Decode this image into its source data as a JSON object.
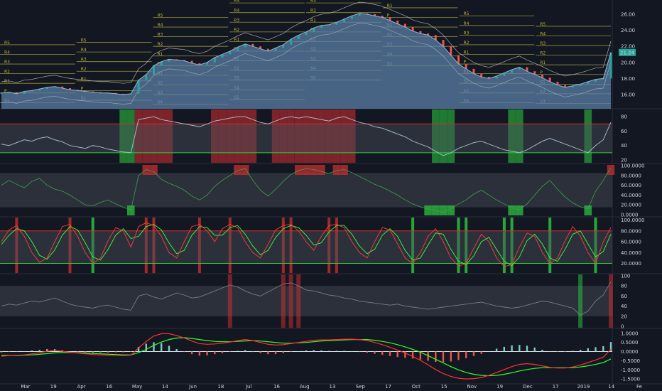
{
  "chart_data": {
    "type": "line",
    "colors": {
      "background": "#131722",
      "area_fill": "#5b7fa6",
      "area_line": "#8fb3d6",
      "candle_up": "#26a69a",
      "candle_down": "#ef5350",
      "pivot_line": "#b7b13a",
      "green_zone": "#2ecc40",
      "red_zone": "#d32f2f",
      "band_fill": "#4a4f5c",
      "oscillator": "#9fb7c9",
      "stoch_k": "#ff3b3b",
      "stoch_d": "#3bff3b",
      "macd_line": "#ff3030",
      "signal_line": "#30ff30",
      "hist_pos": "#80cbc4",
      "hist_neg": "#ef5350"
    },
    "x_ticks": [
      "Mar",
      "19",
      "Apr",
      "16",
      "May",
      "14",
      "Jun",
      "18",
      "Jul",
      "16",
      "Aug",
      "13",
      "Sep",
      "17",
      "Oct",
      "15",
      "Nov",
      "19",
      "Dec",
      "17",
      "2019",
      "14",
      "Fe"
    ],
    "panels": [
      {
        "name": "price",
        "y_ticks": [
          "26.00",
          "24.00",
          "22.00",
          "20.00",
          "18.00",
          "16.00"
        ],
        "ylim": [
          14.5,
          27.5
        ],
        "last_label": "21.24",
        "pivot_labels": [
          "R5",
          "R4",
          "R3",
          "R2",
          "R1",
          "P",
          "S1",
          "S2",
          "S3",
          "S4",
          "S5"
        ],
        "close": [
          16.2,
          16.3,
          16.1,
          16.4,
          16.5,
          16.7,
          16.9,
          17.0,
          16.8,
          16.6,
          16.5,
          16.4,
          16.3,
          16.2,
          16.2,
          16.1,
          16.0,
          16.1,
          17.8,
          18.5,
          19.6,
          20.1,
          20.4,
          20.3,
          20.2,
          19.9,
          19.7,
          20.0,
          20.6,
          21.0,
          21.4,
          21.9,
          22.3,
          22.0,
          21.7,
          21.4,
          21.8,
          22.2,
          22.9,
          23.4,
          23.8,
          24.3,
          24.6,
          24.7,
          25.0,
          25.4,
          25.8,
          26.1,
          26.0,
          25.8,
          25.6,
          25.2,
          24.8,
          24.4,
          23.9,
          23.6,
          23.4,
          22.8,
          22.0,
          20.9,
          19.8,
          19.2,
          18.6,
          18.2,
          18.0,
          18.3,
          18.7,
          19.1,
          19.4,
          18.9,
          18.5,
          18.1,
          17.6,
          17.2,
          16.9,
          17.1,
          17.3,
          17.6,
          17.9,
          18.0,
          21.24
        ]
      },
      {
        "name": "oscillator-1",
        "y_ticks": [
          "80",
          "60",
          "40",
          "20"
        ],
        "ylim": [
          18,
          88
        ],
        "bands": [
          30,
          70
        ],
        "values": [
          42,
          40,
          44,
          48,
          46,
          50,
          52,
          48,
          45,
          40,
          38,
          36,
          40,
          38,
          35,
          33,
          31,
          30,
          76,
          78,
          80,
          76,
          74,
          72,
          70,
          68,
          66,
          70,
          74,
          76,
          78,
          80,
          80,
          76,
          72,
          70,
          74,
          78,
          80,
          78,
          80,
          78,
          76,
          74,
          78,
          80,
          76,
          72,
          70,
          66,
          64,
          60,
          56,
          52,
          46,
          42,
          38,
          32,
          26,
          30,
          36,
          40,
          44,
          46,
          42,
          38,
          34,
          32,
          30,
          34,
          40,
          46,
          50,
          46,
          42,
          38,
          34,
          30,
          40,
          48,
          72
        ]
      },
      {
        "name": "oscillator-2",
        "y_ticks": [
          "100.0000",
          "80.0000",
          "60.0000",
          "40.0000",
          "20.0000",
          "0.0000"
        ],
        "ylim": [
          0,
          100
        ],
        "bands": [
          10,
          90
        ],
        "values": [
          60,
          70,
          62,
          55,
          68,
          74,
          60,
          52,
          48,
          40,
          30,
          20,
          18,
          25,
          30,
          22,
          15,
          10,
          80,
          92,
          88,
          72,
          64,
          58,
          50,
          38,
          30,
          40,
          58,
          70,
          80,
          90,
          94,
          70,
          50,
          38,
          52,
          68,
          82,
          90,
          94,
          92,
          88,
          84,
          90,
          92,
          86,
          78,
          70,
          62,
          56,
          48,
          40,
          30,
          22,
          16,
          12,
          8,
          5,
          12,
          22,
          30,
          42,
          50,
          40,
          30,
          22,
          14,
          10,
          22,
          40,
          58,
          70,
          52,
          36,
          24,
          16,
          12,
          48,
          70,
          96
        ]
      },
      {
        "name": "stochastic",
        "y_ticks": [
          "100.0000",
          "80.0000",
          "60.0000",
          "40.0000",
          "20.0000"
        ],
        "ylim": [
          5,
          102
        ],
        "bands": [
          20,
          80
        ],
        "k": [
          60,
          82,
          90,
          70,
          40,
          22,
          30,
          60,
          88,
          92,
          70,
          40,
          20,
          30,
          62,
          86,
          80,
          50,
          88,
          95,
          90,
          70,
          40,
          30,
          60,
          88,
          92,
          80,
          60,
          84,
          92,
          86,
          60,
          40,
          30,
          55,
          82,
          90,
          92,
          80,
          60,
          44,
          70,
          90,
          92,
          86,
          60,
          40,
          30,
          60,
          86,
          82,
          56,
          30,
          20,
          40,
          70,
          84,
          60,
          30,
          15,
          20,
          48,
          74,
          60,
          30,
          14,
          18,
          50,
          76,
          70,
          40,
          20,
          30,
          62,
          88,
          70,
          40,
          20,
          60,
          86
        ],
        "d": [
          55,
          72,
          84,
          80,
          60,
          35,
          28,
          45,
          72,
          88,
          82,
          58,
          32,
          26,
          46,
          72,
          84,
          66,
          70,
          88,
          92,
          82,
          58,
          38,
          44,
          72,
          88,
          86,
          72,
          72,
          86,
          90,
          74,
          52,
          36,
          44,
          68,
          84,
          90,
          86,
          72,
          54,
          58,
          78,
          90,
          90,
          74,
          52,
          38,
          46,
          72,
          84,
          70,
          44,
          26,
          30,
          54,
          76,
          74,
          46,
          24,
          18,
          34,
          60,
          68,
          46,
          24,
          16,
          32,
          62,
          74,
          56,
          30,
          24,
          46,
          74,
          80,
          56,
          32,
          42,
          74
        ]
      },
      {
        "name": "oscillator-4",
        "y_ticks": [
          "100",
          "80",
          "60",
          "40",
          "20",
          "0"
        ],
        "ylim": [
          0,
          100
        ],
        "bands": [
          20,
          80
        ],
        "values": [
          40,
          44,
          42,
          46,
          50,
          48,
          52,
          56,
          50,
          44,
          40,
          38,
          36,
          40,
          42,
          38,
          34,
          32,
          60,
          64,
          58,
          54,
          60,
          66,
          62,
          56,
          58,
          64,
          70,
          76,
          82,
          78,
          70,
          64,
          60,
          68,
          76,
          84,
          86,
          80,
          72,
          70,
          66,
          62,
          60,
          56,
          54,
          50,
          48,
          46,
          44,
          42,
          44,
          40,
          38,
          36,
          34,
          36,
          38,
          40,
          42,
          44,
          46,
          48,
          44,
          40,
          38,
          36,
          38,
          42,
          46,
          50,
          48,
          44,
          40,
          36,
          22,
          30,
          50,
          62,
          88
        ]
      },
      {
        "name": "macd",
        "y_ticks": [
          "1.0000",
          "0.5000",
          "0.0000",
          "-0.5000",
          "-1.0000",
          "-1.5000"
        ],
        "ylim": [
          -1.65,
          1.15
        ],
        "macd": [
          -0.25,
          -0.22,
          -0.2,
          -0.18,
          -0.12,
          -0.06,
          0.02,
          0.06,
          0.02,
          -0.04,
          -0.08,
          -0.12,
          -0.16,
          -0.18,
          -0.19,
          -0.2,
          -0.22,
          -0.2,
          0.2,
          0.55,
          0.85,
          0.98,
          0.98,
          0.88,
          0.74,
          0.58,
          0.44,
          0.4,
          0.42,
          0.46,
          0.52,
          0.6,
          0.66,
          0.6,
          0.5,
          0.4,
          0.36,
          0.38,
          0.44,
          0.5,
          0.56,
          0.62,
          0.64,
          0.64,
          0.66,
          0.68,
          0.68,
          0.66,
          0.6,
          0.5,
          0.38,
          0.24,
          0.08,
          -0.08,
          -0.26,
          -0.48,
          -0.72,
          -0.98,
          -1.2,
          -1.36,
          -1.46,
          -1.5,
          -1.48,
          -1.42,
          -1.3,
          -1.14,
          -0.98,
          -0.82,
          -0.7,
          -0.66,
          -0.7,
          -0.78,
          -0.86,
          -0.9,
          -0.9,
          -0.84,
          -0.74,
          -0.6,
          -0.46,
          -0.3,
          0.12
        ],
        "signal": [
          -0.2,
          -0.21,
          -0.21,
          -0.2,
          -0.18,
          -0.15,
          -0.11,
          -0.07,
          -0.05,
          -0.05,
          -0.06,
          -0.08,
          -0.1,
          -0.12,
          -0.14,
          -0.16,
          -0.18,
          -0.18,
          -0.06,
          0.12,
          0.34,
          0.52,
          0.66,
          0.74,
          0.76,
          0.72,
          0.66,
          0.6,
          0.56,
          0.54,
          0.54,
          0.56,
          0.58,
          0.6,
          0.58,
          0.54,
          0.5,
          0.46,
          0.46,
          0.48,
          0.5,
          0.54,
          0.58,
          0.6,
          0.62,
          0.64,
          0.66,
          0.66,
          0.66,
          0.62,
          0.56,
          0.48,
          0.38,
          0.26,
          0.12,
          -0.04,
          -0.22,
          -0.42,
          -0.62,
          -0.82,
          -1.0,
          -1.14,
          -1.24,
          -1.3,
          -1.32,
          -1.3,
          -1.24,
          -1.16,
          -1.06,
          -0.98,
          -0.92,
          -0.88,
          -0.88,
          -0.88,
          -0.88,
          -0.88,
          -0.84,
          -0.78,
          -0.7,
          -0.6,
          -0.4
        ]
      }
    ]
  }
}
